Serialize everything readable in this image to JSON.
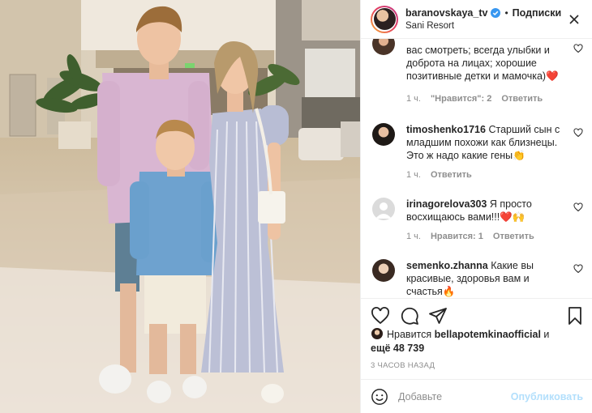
{
  "post": {
    "username": "baranovskaya_tv",
    "follow_label": "Подписки",
    "location": "Sani Resort",
    "separator": "•"
  },
  "comments": [
    {
      "user": "",
      "text": "вас смотреть; всегда улыбки и доброта на лицах; хорошие позитивные детки и мамочка)❤️",
      "time": "1 ч.",
      "likes": "\"Нравится\": 2",
      "reply": "Ответить"
    },
    {
      "user": "timoshenko1716",
      "text": "Старший сын с младшим похожи как близнецы. Это ж надо какие гены👏",
      "time": "1 ч.",
      "likes": "",
      "reply": "Ответить"
    },
    {
      "user": "irinagorelova303",
      "text": "Я просто восхищаюсь вами!!!❤️🙌",
      "time": "1 ч.",
      "likes": "Нравится: 1",
      "reply": "Ответить"
    },
    {
      "user": "semenko.zhanna",
      "text": "Какие вы красивые, здоровья вам и счастья🔥",
      "time": "",
      "likes": "",
      "reply": ""
    }
  ],
  "likes_line": {
    "prefix": "Нравится",
    "user": "bellapotemkinaofficial",
    "conj": "и",
    "others": "ещё 48 739"
  },
  "time_ago": "3 ЧАСОВ НАЗАД",
  "add_comment": {
    "placeholder": "Добавьте",
    "publish": "Опубликовать"
  },
  "colors": {
    "text": "#262626",
    "muted": "#8e8e8e",
    "verified": "#3897f0",
    "publish_disabled": "#b2dffc",
    "border": "#efefef"
  }
}
